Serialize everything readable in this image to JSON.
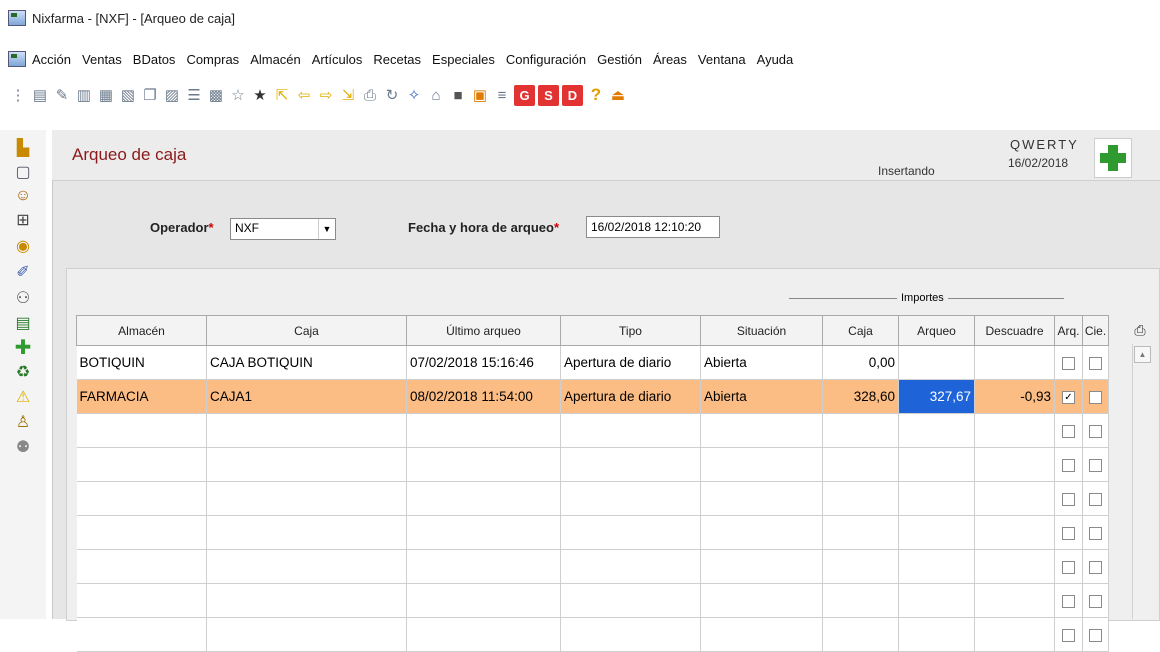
{
  "window": {
    "title": "Nixfarma - [NXF] - [Arqueo de caja]"
  },
  "menu": [
    "Acción",
    "Ventas",
    "BDatos",
    "Compras",
    "Almacén",
    "Artículos",
    "Recetas",
    "Especiales",
    "Configuración",
    "Gestión",
    "Áreas",
    "Ventana",
    "Ayuda"
  ],
  "toolbar": {
    "g": "G",
    "s": "S",
    "d": "D",
    "help": "?"
  },
  "header": {
    "title": "Arqueo de caja",
    "status": "Insertando",
    "company": "QWERTY",
    "date": "16/02/2018"
  },
  "filters": {
    "operador_label": "Operador",
    "operador_value": "NXF",
    "fecha_label": "Fecha y hora de arqueo",
    "fecha_value": "16/02/2018 12:10:20",
    "required_mark": "*"
  },
  "grid": {
    "group_label": "Importes",
    "columns": [
      "Almacén",
      "Caja",
      "Último arqueo",
      "Tipo",
      "Situación",
      "Caja",
      "Arqueo",
      "Descuadre",
      "Arq.",
      "Cie."
    ],
    "rows": [
      {
        "almacen": "BOTIQUIN",
        "caja": "CAJA BOTIQUIN",
        "ultimo": "07/02/2018 15:16:46",
        "tipo": "Apertura de diario",
        "situacion": "Abierta",
        "importe_caja": "0,00",
        "arqueo": "",
        "descuadre": "",
        "arq_checked": false,
        "cie_checked": false
      },
      {
        "almacen": "FARMACIA",
        "caja": "CAJA1",
        "ultimo": "08/02/2018 11:54:00",
        "tipo": "Apertura de diario",
        "situacion": "Abierta",
        "importe_caja": "328,60",
        "arqueo": "327,67",
        "descuadre": "-0,93",
        "arq_checked": true,
        "cie_checked": false
      }
    ],
    "empty_rows": 7,
    "check_mark": "✓"
  }
}
